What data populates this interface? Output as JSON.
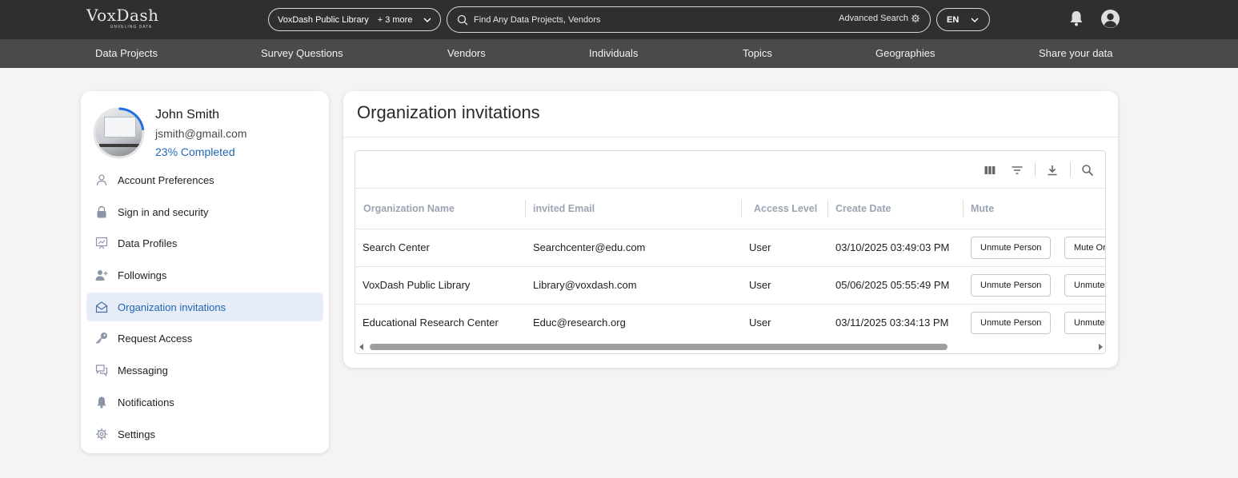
{
  "brand": {
    "logo_text": "VoxDash",
    "logo_tagline": "UNVELING DATA"
  },
  "header": {
    "library_selector": {
      "selected": "VoxDash Public Library",
      "extra": "+ 3 more"
    },
    "search": {
      "placeholder": "Find Any Data Projects, Vendors",
      "advanced_label": "Advanced Search"
    },
    "language": "EN",
    "icons": [
      "bell-icon",
      "user-circle-icon"
    ]
  },
  "nav": {
    "items": [
      {
        "label": "Data Projects"
      },
      {
        "label": "Survey Questions"
      },
      {
        "label": "Vendors"
      },
      {
        "label": "Individuals"
      },
      {
        "label": "Topics"
      },
      {
        "label": "Geographies"
      },
      {
        "label": "Share your data"
      }
    ]
  },
  "profile": {
    "name": "John Smith",
    "email": "jsmith@gmail.com",
    "completion_text": "23% Completed",
    "completion_fraction": 0.23
  },
  "sidebar": {
    "items": [
      {
        "label": "Account Preferences",
        "icon": "person-icon",
        "active": false
      },
      {
        "label": "Sign in and security",
        "icon": "lock-icon",
        "active": false
      },
      {
        "label": "Data Profiles",
        "icon": "presentation-chart-icon",
        "active": false
      },
      {
        "label": "Followings",
        "icon": "person-plus-icon",
        "active": false
      },
      {
        "label": "Organization invitations",
        "icon": "envelope-open-icon",
        "active": true
      },
      {
        "label": "Request Access",
        "icon": "key-icon",
        "active": false
      },
      {
        "label": "Messaging",
        "icon": "chat-bubbles-icon",
        "active": false
      },
      {
        "label": "Notifications",
        "icon": "bell-icon",
        "active": false
      },
      {
        "label": "Settings",
        "icon": "gear-icon",
        "active": false
      }
    ]
  },
  "main": {
    "title": "Organization invitations",
    "toolbar_icons": [
      "columns-icon",
      "filter-icon",
      "download-icon",
      "search-icon"
    ],
    "table": {
      "columns": [
        "Organization Name",
        "invited Email",
        "Access Level",
        "Create Date",
        "Mute"
      ],
      "rows": [
        {
          "organization": "Search Center",
          "email": "Searchcenter@edu.com",
          "access": "User",
          "date": "03/10/2025 03:49:03 PM",
          "mute_person": "Unmute Person",
          "mute_org": "Mute Or"
        },
        {
          "organization": "VoxDash Public Library",
          "email": "Library@voxdash.com",
          "access": "User",
          "date": "05/06/2025 05:55:49 PM",
          "mute_person": "Unmute Person",
          "mute_org": "Unmute"
        },
        {
          "organization": "Educational Research Center",
          "email": "Educ@research.org",
          "access": "User",
          "date": "03/11/2025 03:34:13 PM",
          "mute_person": "Unmute Person",
          "mute_org": "Unmute"
        }
      ]
    },
    "horizontal_scroll_fraction": 0.8
  },
  "colors": {
    "topbar": "#2f2f2f",
    "navbar": "#4a4a4a",
    "accent_blue": "#2166b3",
    "active_bg": "#e6edf7",
    "header_text": "#9aa4b2"
  }
}
